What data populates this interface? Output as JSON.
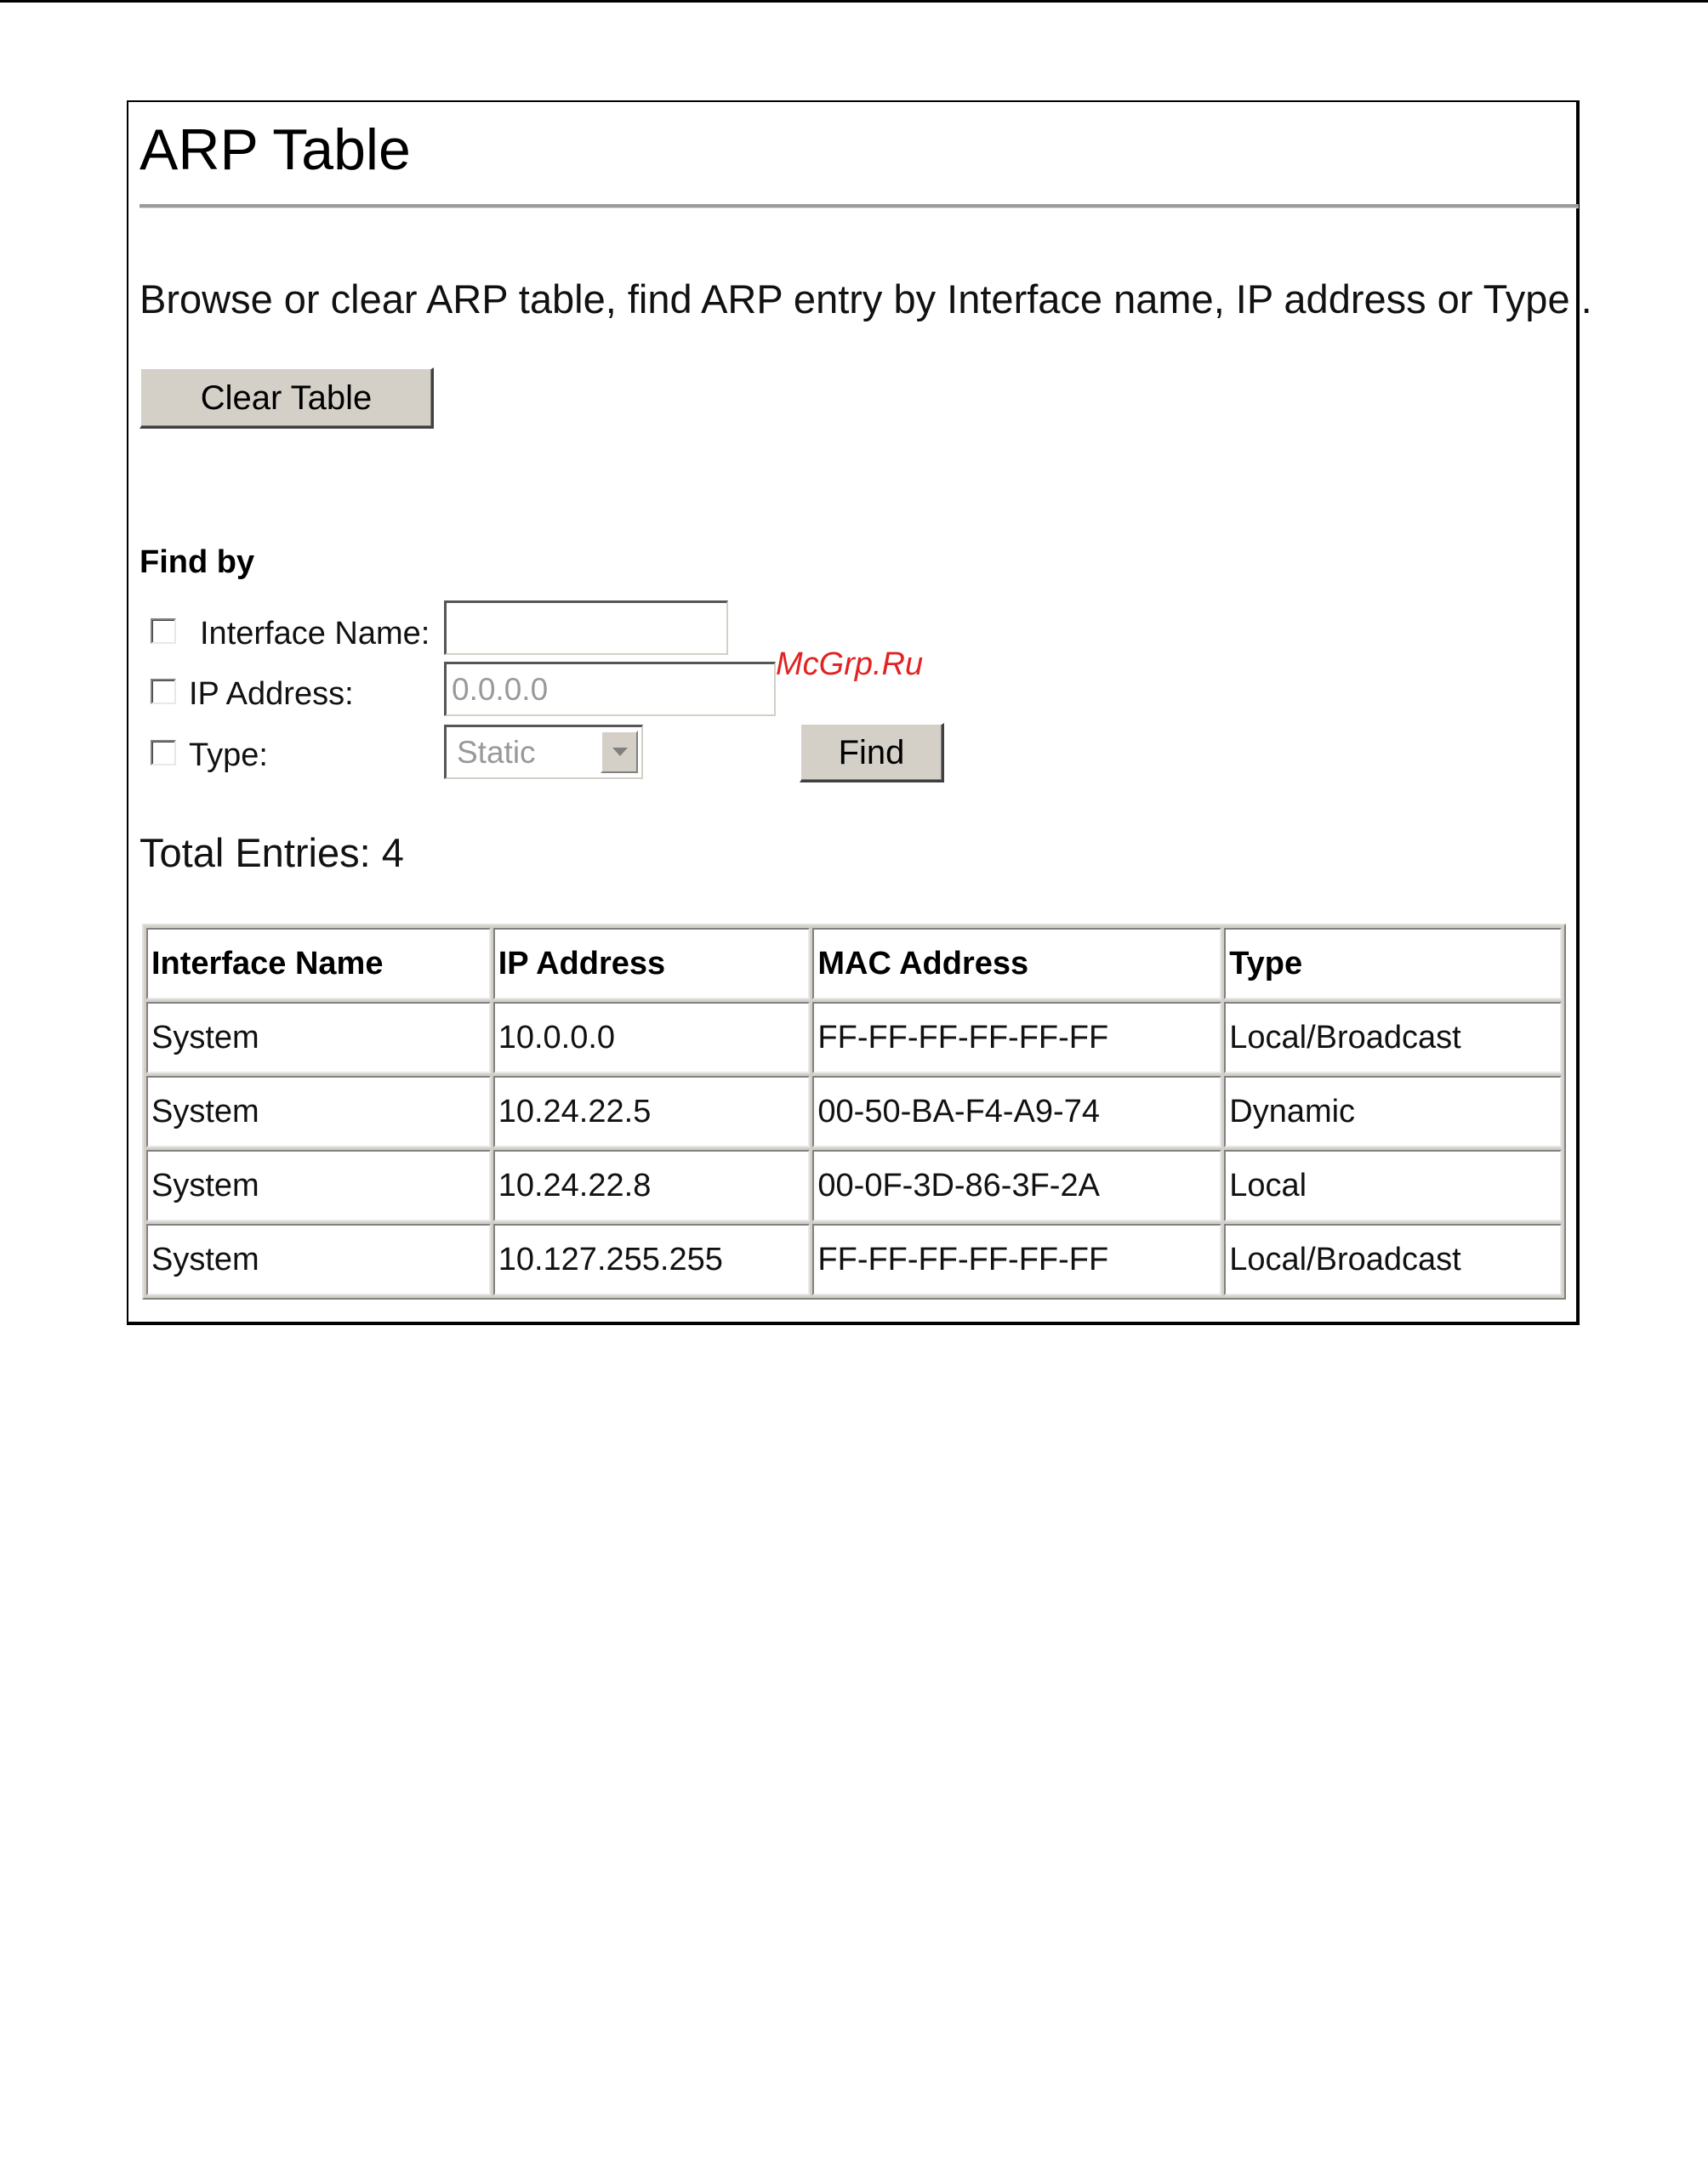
{
  "page": {
    "title": "ARP Table",
    "description": "Browse or clear ARP table, find ARP entry by Interface name, IP address or Type ."
  },
  "actions": {
    "clear_table_label": "Clear Table",
    "find_label": "Find"
  },
  "find_by": {
    "heading": "Find by",
    "interface_name": {
      "label": "Interface Name:",
      "value": "",
      "checked": false
    },
    "ip_address": {
      "label": "IP Address:",
      "value": "0.0.0.0",
      "checked": false
    },
    "type": {
      "label": "Type:",
      "selected": "Static",
      "checked": false
    }
  },
  "watermark": "McGrp.Ru",
  "summary": {
    "total_entries": "Total Entries: 4"
  },
  "table": {
    "headers": [
      "Interface Name",
      "IP Address",
      "MAC Address",
      "Type"
    ],
    "rows": [
      [
        "System",
        "10.0.0.0",
        "FF-FF-FF-FF-FF-FF",
        "Local/Broadcast"
      ],
      [
        "System",
        "10.24.22.5",
        "00-50-BA-F4-A9-74",
        "Dynamic"
      ],
      [
        "System",
        "10.24.22.8",
        "00-0F-3D-86-3F-2A",
        "Local"
      ],
      [
        "System",
        "10.127.255.255",
        "FF-FF-FF-FF-FF-FF",
        "Local/Broadcast"
      ]
    ]
  }
}
